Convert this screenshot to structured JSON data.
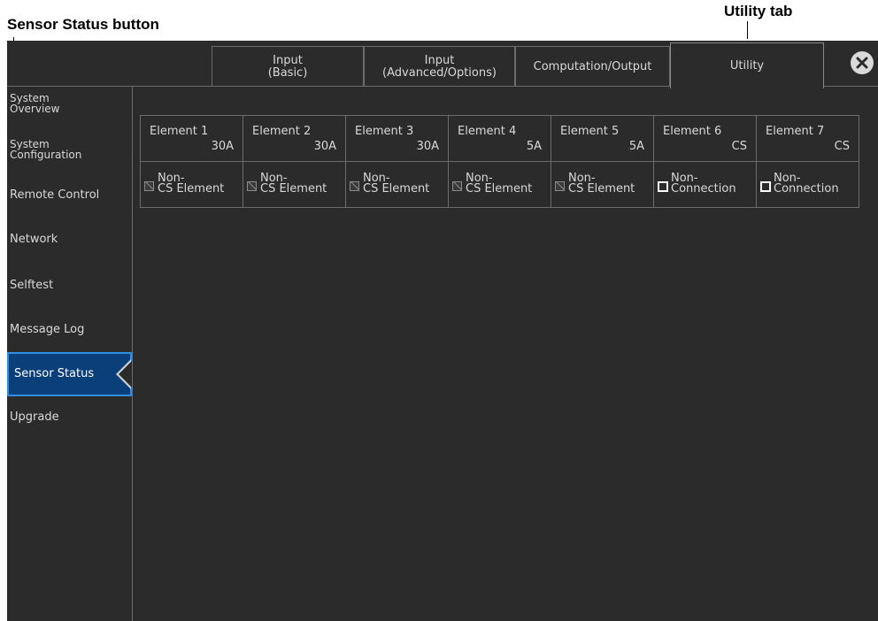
{
  "callouts": {
    "sensor_status_button": "Sensor Status button",
    "utility_tab": "Utility tab"
  },
  "tabs": [
    {
      "line1": "Input",
      "line2": "(Basic)",
      "active": false
    },
    {
      "line1": "Input",
      "line2": "(Advanced/Options)",
      "active": false
    },
    {
      "line1": "Computation/Output",
      "line2": "",
      "active": false
    },
    {
      "line1": "Utility",
      "line2": "",
      "active": true
    }
  ],
  "close_icon": "close-circle-icon",
  "sidebar": {
    "items": [
      {
        "line1": "System",
        "line2": "Overview"
      },
      {
        "line1": "System",
        "line2": "Configuration"
      },
      {
        "line1": "Remote Control",
        "line2": ""
      },
      {
        "line1": "Network",
        "line2": ""
      },
      {
        "line1": "Selftest",
        "line2": ""
      },
      {
        "line1": "Message Log",
        "line2": ""
      },
      {
        "line1": "Sensor Status",
        "line2": "",
        "active": true
      },
      {
        "line1": "Upgrade",
        "line2": ""
      }
    ]
  },
  "elements": [
    {
      "name": "Element 1",
      "range": "30A",
      "status1": "Non-",
      "status2": "CS Element",
      "icon": "disabled-checkbox-icon"
    },
    {
      "name": "Element 2",
      "range": "30A",
      "status1": "Non-",
      "status2": "CS Element",
      "icon": "disabled-checkbox-icon"
    },
    {
      "name": "Element 3",
      "range": "30A",
      "status1": "Non-",
      "status2": "CS Element",
      "icon": "disabled-checkbox-icon"
    },
    {
      "name": "Element 4",
      "range": "5A",
      "status1": "Non-",
      "status2": "CS Element",
      "icon": "disabled-checkbox-icon"
    },
    {
      "name": "Element 5",
      "range": "5A",
      "status1": "Non-",
      "status2": "CS Element",
      "icon": "disabled-checkbox-icon"
    },
    {
      "name": "Element 6",
      "range": "CS",
      "status1": "Non-",
      "status2": "Connection",
      "icon": "empty-square-icon"
    },
    {
      "name": "Element 7",
      "range": "CS",
      "status1": "Non-",
      "status2": "Connection",
      "icon": "empty-square-icon"
    }
  ],
  "colors": {
    "background": "#2b2b2b",
    "active_item": "#0a3f7a",
    "active_border": "#2f8fe6"
  }
}
